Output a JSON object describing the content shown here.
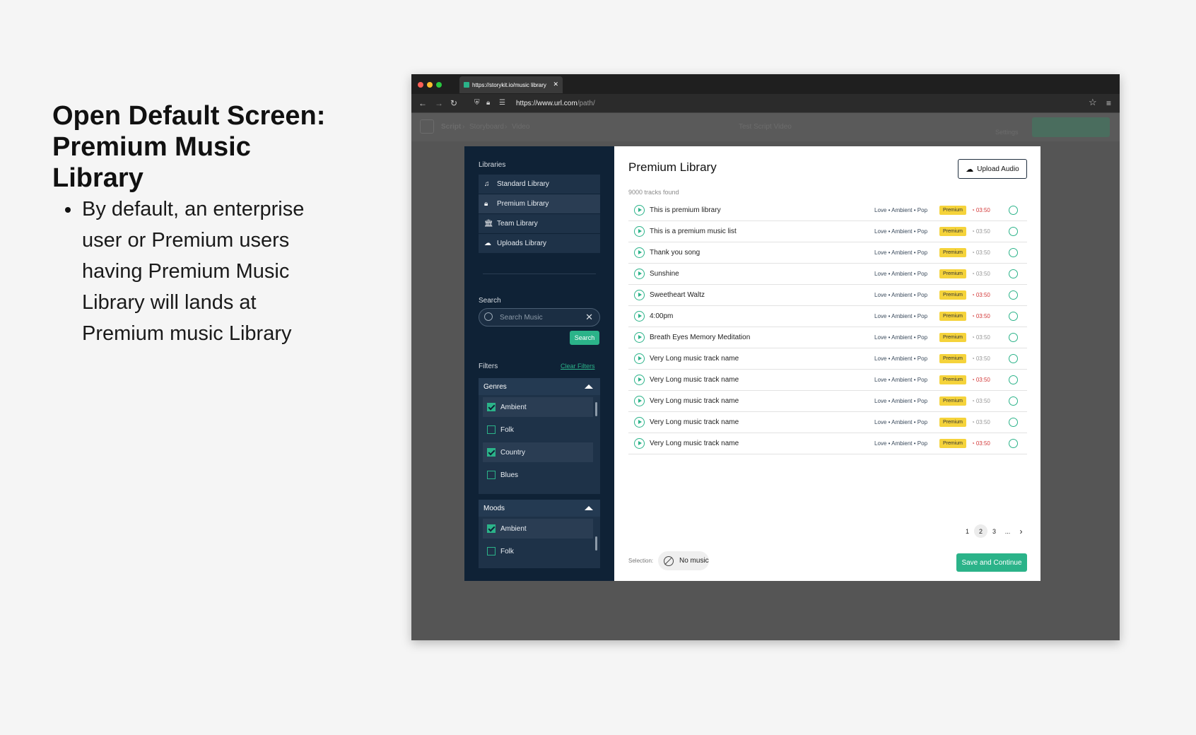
{
  "slide": {
    "heading_line1": "Open Default Screen:",
    "heading_line2": "Premium Music Library",
    "bullet": "By default, an enterprise user  or Premium users having Premium Music Library will lands at Premium music Library"
  },
  "browser": {
    "tab_title": "https://storykit.io/music library",
    "url_host": "https://www.url.com",
    "url_path": "/path/"
  },
  "app_header": {
    "breadcrumb_script": "Script",
    "breadcrumb_storyboard": "Storyboard",
    "breadcrumb_video": "Video",
    "project_title": "Test Script Video",
    "settings": "Settings"
  },
  "sidebar": {
    "libraries_label": "Libraries",
    "libraries": [
      {
        "label": "Standard Library",
        "icon": "music-note-icon"
      },
      {
        "label": "Premium Library",
        "icon": "lock-icon",
        "active": true
      },
      {
        "label": "Team Library",
        "icon": "building-icon"
      },
      {
        "label": "Uploads Library",
        "icon": "cloud-upload-icon"
      }
    ],
    "search_label": "Search",
    "search_placeholder": "Search Music",
    "search_button": "Search",
    "filters_label": "Filters",
    "clear_filters": "Clear Filters",
    "genres": {
      "title": "Genres",
      "options": [
        {
          "label": "Ambient",
          "checked": true
        },
        {
          "label": "Folk",
          "checked": false
        },
        {
          "label": "Country",
          "checked": true
        },
        {
          "label": "Blues",
          "checked": false
        }
      ]
    },
    "moods": {
      "title": "Moods",
      "options": [
        {
          "label": "Ambient",
          "checked": true
        },
        {
          "label": "Folk",
          "checked": false
        }
      ]
    }
  },
  "main": {
    "title": "Premium Library",
    "upload_button": "Upload Audio",
    "tracks_found": "9000 tracks found",
    "tag1": "Love",
    "tag2": "Ambient",
    "tag3": "Pop",
    "badge": "Premium",
    "tracks": [
      {
        "name": "This is premium library",
        "duration": "03:50",
        "highlight": true
      },
      {
        "name": "This is a premium music list",
        "duration": "03:50",
        "highlight": false
      },
      {
        "name": "Thank you song",
        "duration": "03:50",
        "highlight": false
      },
      {
        "name": "Sunshine",
        "duration": "03:50",
        "highlight": false
      },
      {
        "name": "Sweetheart Waltz",
        "duration": "03:50",
        "highlight": true
      },
      {
        "name": "4:00pm",
        "duration": "03:50",
        "highlight": true
      },
      {
        "name": "Breath Eyes Memory Meditation",
        "duration": "03:50",
        "highlight": false
      },
      {
        "name": "Very Long music track name",
        "duration": "03:50",
        "highlight": false
      },
      {
        "name": "Very Long music track name",
        "duration": "03:50",
        "highlight": true
      },
      {
        "name": "Very Long music track name",
        "duration": "03:50",
        "highlight": false
      },
      {
        "name": "Very Long music track name",
        "duration": "03:50",
        "highlight": false
      },
      {
        "name": "Very Long music track name",
        "duration": "03:50",
        "highlight": true
      }
    ],
    "pagination": [
      "1",
      "2",
      "3",
      "..."
    ],
    "current_page": "2",
    "selection_label": "Selection:",
    "no_music": "No music",
    "save_button": "Save and Continue"
  },
  "colors": {
    "accent": "#2bb389",
    "sidebar_bg": "#0f2236",
    "premium_badge": "#f5d33b",
    "duration_red": "#d43b3b"
  }
}
